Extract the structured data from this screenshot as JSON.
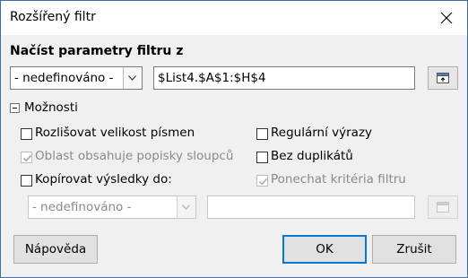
{
  "window": {
    "title": "Rozšířený filtr",
    "close_icon": "close-icon"
  },
  "load_section": {
    "title": "Načíst parametry filtru z",
    "source_select": {
      "value": "- nedefinováno -"
    },
    "range_input": {
      "value": "$List4.$A$1:$H$4"
    },
    "shrink_icon": "shrink-dialog-icon"
  },
  "options": {
    "title": "Možnosti",
    "expanded": true,
    "case_sensitive": {
      "label": "Rozlišovat velikost písmen",
      "checked": false,
      "enabled": true
    },
    "regex": {
      "label": "Regulární výrazy",
      "checked": false,
      "enabled": true
    },
    "contains_headers": {
      "label": "Oblast obsahuje popisky sloupců",
      "checked": true,
      "enabled": false
    },
    "no_duplicates": {
      "label": "Bez duplikátů",
      "checked": false,
      "enabled": true
    },
    "copy_results": {
      "label": "Kopírovat výsledky do:",
      "checked": false,
      "enabled": true
    },
    "keep_criteria": {
      "label": "Ponechat kritéria filtru",
      "checked": true,
      "enabled": false
    },
    "output_select": {
      "value": "- nedefinováno -",
      "enabled": false
    },
    "output_input": {
      "value": "",
      "enabled": false
    }
  },
  "buttons": {
    "help": "Nápověda",
    "ok": "OK",
    "cancel": "Zrušit"
  },
  "colors": {
    "accent": "#0078d7",
    "window_border": "#3d6ea6",
    "background": "#f0f0f0"
  }
}
